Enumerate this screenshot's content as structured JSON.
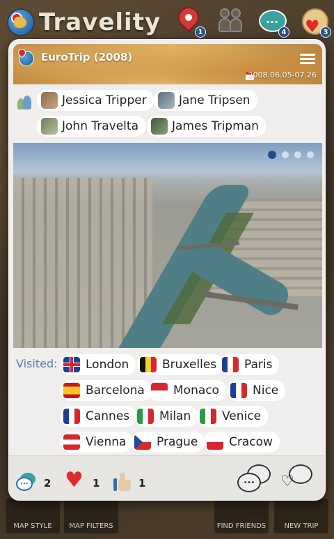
{
  "app": {
    "title": "Travelity",
    "badges": {
      "pins": "1",
      "comments": "4",
      "likes": "3"
    }
  },
  "bottom_nav": {
    "map_style": "MAP STYLE",
    "map_filters": "MAP FILTERS",
    "find_friends": "FIND FRIENDS",
    "new_trip": "NEW TRIP"
  },
  "trip": {
    "title": "EuroTrip (2008)",
    "dates": "2008.06.05-07.26",
    "participants": [
      {
        "name": "Jessica Tripper"
      },
      {
        "name": "Jane Tripsen"
      },
      {
        "name": "John Travelta"
      },
      {
        "name": "James Tripman"
      }
    ],
    "gallery": {
      "active_index": 0,
      "count": 4
    },
    "visited_label": "Visited:",
    "cities": [
      {
        "name": "London",
        "flag": "uk"
      },
      {
        "name": "Bruxelles",
        "flag": "be"
      },
      {
        "name": "Paris",
        "flag": "fr"
      },
      {
        "name": "Barcelona",
        "flag": "es"
      },
      {
        "name": "Monaco",
        "flag": "mc"
      },
      {
        "name": "Nice",
        "flag": "fr"
      },
      {
        "name": "Cannes",
        "flag": "fr"
      },
      {
        "name": "Milan",
        "flag": "it"
      },
      {
        "name": "Venice",
        "flag": "it"
      },
      {
        "name": "Vienna",
        "flag": "at"
      },
      {
        "name": "Prague",
        "flag": "cz"
      },
      {
        "name": "Cracow",
        "flag": "pl"
      }
    ],
    "stats": {
      "comments": "2",
      "likes": "1",
      "thumbs": "1"
    },
    "comment_icon_text": "..."
  }
}
